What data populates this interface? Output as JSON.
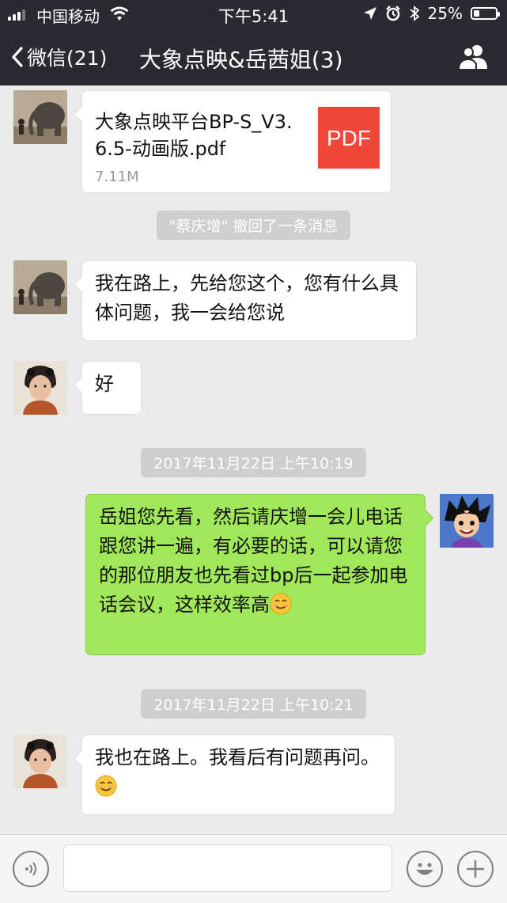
{
  "status": {
    "carrier": "中国移动",
    "time": "下午5:41",
    "battery_text": "25%",
    "battery_level": 0.25
  },
  "navbar": {
    "back_label": "微信(21)",
    "title": "大象点映&岳茜姐(3)"
  },
  "messages": {
    "file": {
      "name": "大象点映平台BP-S_V3.6.5-动画版.pdf",
      "size": "7.11M",
      "icon_label": "PDF"
    },
    "recall_notice": "\"蔡庆增\" 撤回了一条消息",
    "msg1": "我在路上，先给您这个，您有什么具体问题，我一会给您说",
    "msg2": "好",
    "timestamp1": "2017年11月22日 上午10:19",
    "msg3": "岳姐您先看，然后请庆增一会儿电话跟您讲一遍，有必要的话，可以请您的那位朋友也先看过bp后一起参加电话会议，这样效率高",
    "timestamp2": "2017年11月22日 上午10:21",
    "msg4": "我也在路上。我看后有问题再问。"
  },
  "input": {
    "placeholder": ""
  },
  "colors": {
    "navbar_bg": "#2b2a30",
    "chat_bg": "#ebebeb",
    "out_bubble": "#a0e75a",
    "pdf_red": "#f0473a"
  },
  "icons": {
    "voice": "voice-icon",
    "emoji": "emoji-icon",
    "more": "plus-icon",
    "contacts": "contacts-icon",
    "back": "chevron-left-icon"
  }
}
